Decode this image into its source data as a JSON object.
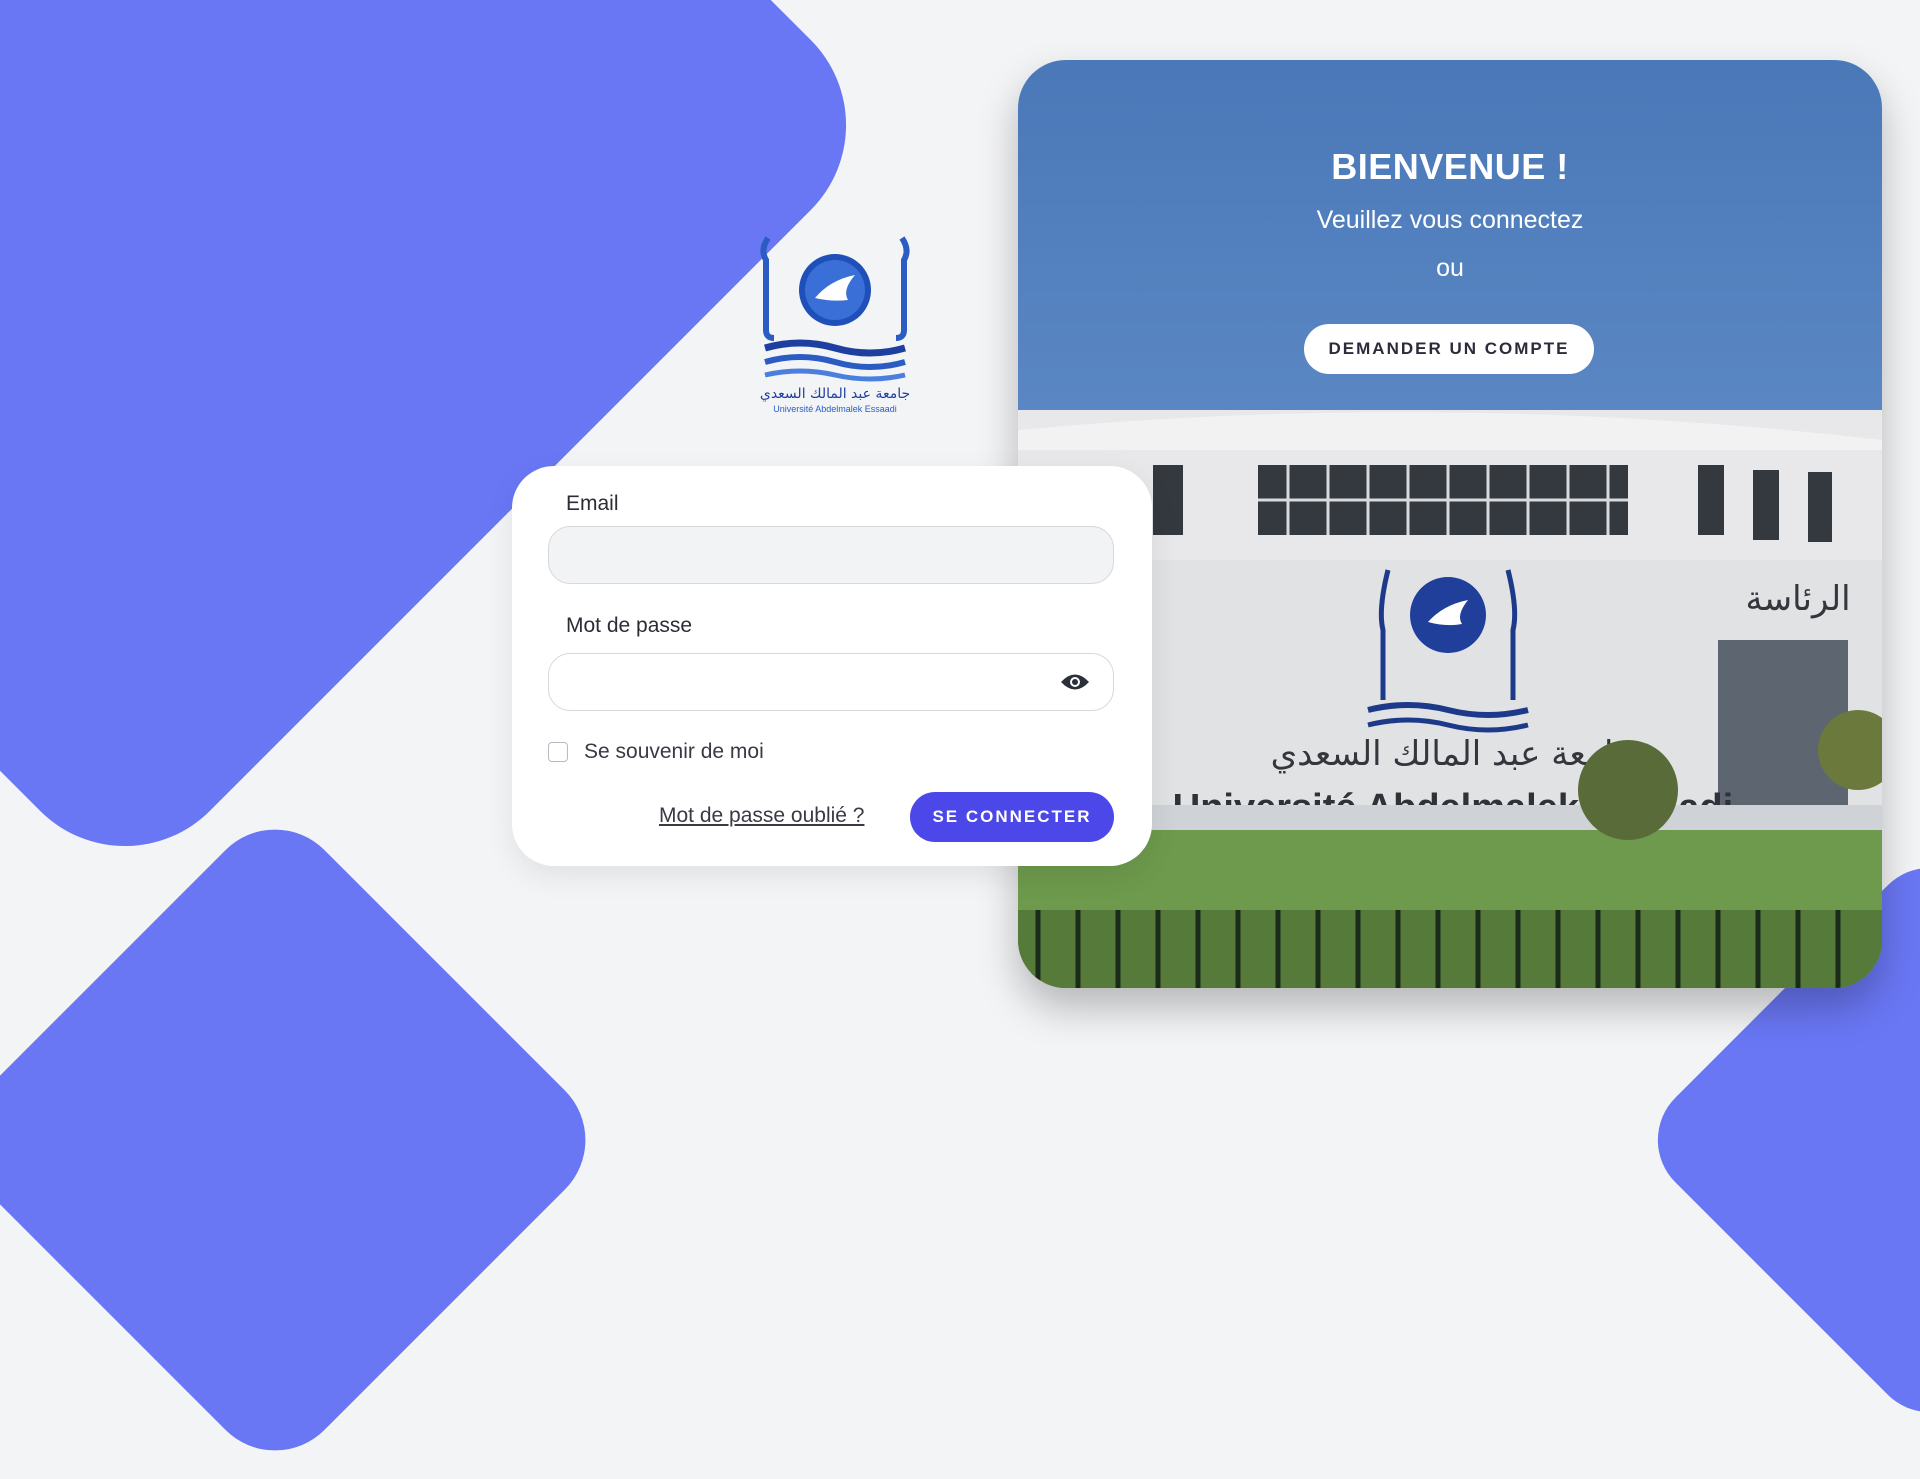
{
  "logo": {
    "arabic_text": "جامعة عبد المالك السعدي",
    "latin_text": "Université Abdelmalek Essaadi"
  },
  "hero": {
    "title": "BIENVENUE !",
    "subtitle": "Veuillez vous connectez",
    "or_text": "ou",
    "request_account_label": "DEMANDER UN COMPTE",
    "building_sign_arabic": "جامعة عبد المالك السعدي",
    "building_sign_latin": "Université Abdelmalek Essaadi",
    "building_sign_right": "الرئاسة"
  },
  "login": {
    "email_label": "Email",
    "email_value": "",
    "password_label": "Mot de passe",
    "password_value": "",
    "remember_label": "Se souvenir de moi",
    "remember_checked": false,
    "forgot_label": "Mot de passe oublié ?",
    "submit_label": "SE CONNECTER"
  },
  "colors": {
    "accent": "#4c47e8",
    "background_shape": "#6a77f5",
    "page_bg": "#f3f4f6"
  },
  "icons": {
    "password_toggle": "eye-icon",
    "logo": "dove-globe-logo"
  }
}
